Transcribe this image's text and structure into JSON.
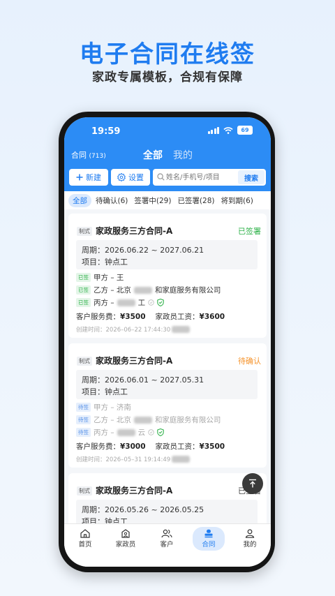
{
  "promo": {
    "title": "电子合同在线签",
    "subtitle": "家政专属模板，合规有保障"
  },
  "status_bar": {
    "time": "19:59",
    "battery": "69"
  },
  "header": {
    "left_label": "合同",
    "left_count": "(713)",
    "tab_all": "全部",
    "tab_mine": "我的"
  },
  "toolbar": {
    "new_label": "新建",
    "settings_label": "设置",
    "search_placeholder": "姓名/手机号/项目",
    "search_button": "搜索"
  },
  "filters": [
    "全部",
    "待确认(6)",
    "签署中(29)",
    "已签署(28)",
    "将到期(6)"
  ],
  "colors": {
    "primary": "#2c8cf5",
    "signed": "#2fb24a",
    "pending": "#f5932b"
  },
  "contracts": [
    {
      "tag": "制式",
      "title": "家政服务三方合同-A",
      "status": "已签署",
      "period": "周期：2026.06.22 ~ 2027.06.21",
      "project": "项目：钟点工",
      "party_a_tag": "已签",
      "party_a": "甲方 – 王",
      "party_b_tag": "已签",
      "party_b_prefix": "乙方 – 北京",
      "party_b_suffix": "和家庭服务有限公司",
      "party_c_tag": "已签",
      "party_c_prefix": "丙方 –",
      "party_c_suffix": "工",
      "client_fee_label": "客户服务费：",
      "client_fee": "¥3500",
      "worker_wage_label": "家政员工资：",
      "worker_wage": "¥3600",
      "created": "创建时间：2026–06–22 17:44:30"
    },
    {
      "tag": "制式",
      "title": "家政服务三方合同-A",
      "status": "待确认",
      "period": "周期：2026.06.01 ~ 2027.05.31",
      "project": "项目：钟点工",
      "party_a_tag": "待签",
      "party_a": "甲方 – 济南",
      "party_b_tag": "待签",
      "party_b_prefix": "乙方 – 北京",
      "party_b_suffix": "和家庭服务有限公司",
      "party_c_tag": "待签",
      "party_c_prefix": "丙方 –",
      "party_c_suffix": "云",
      "client_fee_label": "客户服务费：",
      "client_fee": "¥3000",
      "worker_wage_label": "家政员工资：",
      "worker_wage": "¥3500",
      "created": "创建时间：2026–05–31 19:14:49"
    },
    {
      "tag": "制式",
      "title": "家政服务三方合同-A",
      "status": "已签署",
      "period": "周期：2026.05.26 ~ 2026.05.25",
      "project": "项目：钟点工"
    }
  ],
  "bottom_nav": [
    {
      "label": "首页",
      "icon": "home-icon"
    },
    {
      "label": "家政员",
      "icon": "housekeeper-icon"
    },
    {
      "label": "客户",
      "icon": "customer-icon"
    },
    {
      "label": "合同",
      "icon": "contract-icon",
      "active": true
    },
    {
      "label": "我的",
      "icon": "profile-icon"
    }
  ]
}
